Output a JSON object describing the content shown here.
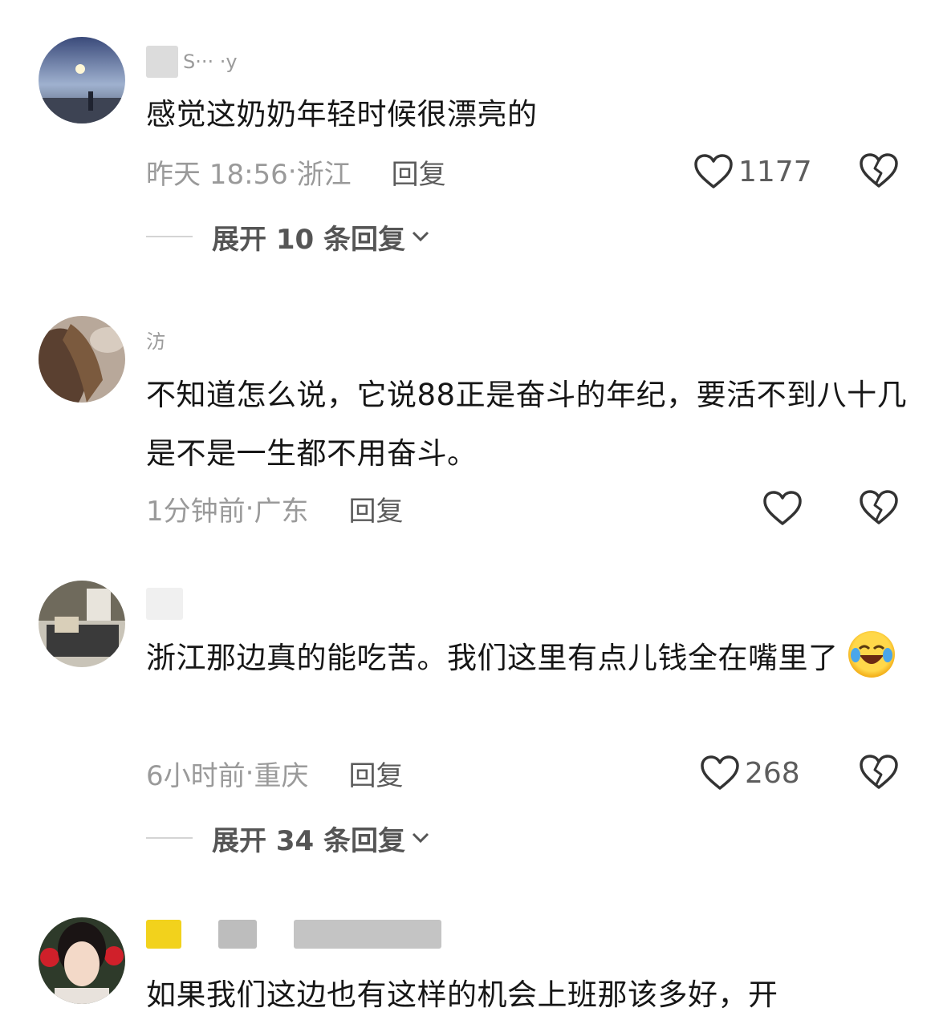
{
  "comments": [
    {
      "username": "S··· ·y",
      "text": "感觉这奶奶年轻时候很漂亮的",
      "time": "昨天 18:56",
      "location": "浙江",
      "reply_label": "回复",
      "likes": "1177",
      "expand_label": "展开 10 条回复"
    },
    {
      "username": "汸",
      "text": "不知道怎么说，它说88正是奋斗的年纪，要活不到八十几是不是一生都不用奋斗。",
      "time": "1分钟前",
      "location": "广东",
      "reply_label": "回复",
      "likes": ""
    },
    {
      "username": "",
      "text": "浙江那边真的能吃苦。我们这里有点儿钱全在嘴里了",
      "time": "6小时前",
      "location": "重庆",
      "reply_label": "回复",
      "likes": "268",
      "expand_label": "展开 34 条回复"
    },
    {
      "username": "",
      "text": "如果我们这边也有这样的机会上班那该多好，开",
      "time": "",
      "location": "",
      "reply_label": "",
      "likes": ""
    }
  ],
  "separator": " · ",
  "icons": {
    "like": "heart-outline-icon",
    "dislike": "broken-heart-icon",
    "expand": "chevron-down-icon",
    "emoji": "rolling-laughing-face-icon"
  },
  "colors": {
    "text": "#161616",
    "meta": "#9a9a9a",
    "reply": "#5b5b5b",
    "expand": "#555555"
  }
}
